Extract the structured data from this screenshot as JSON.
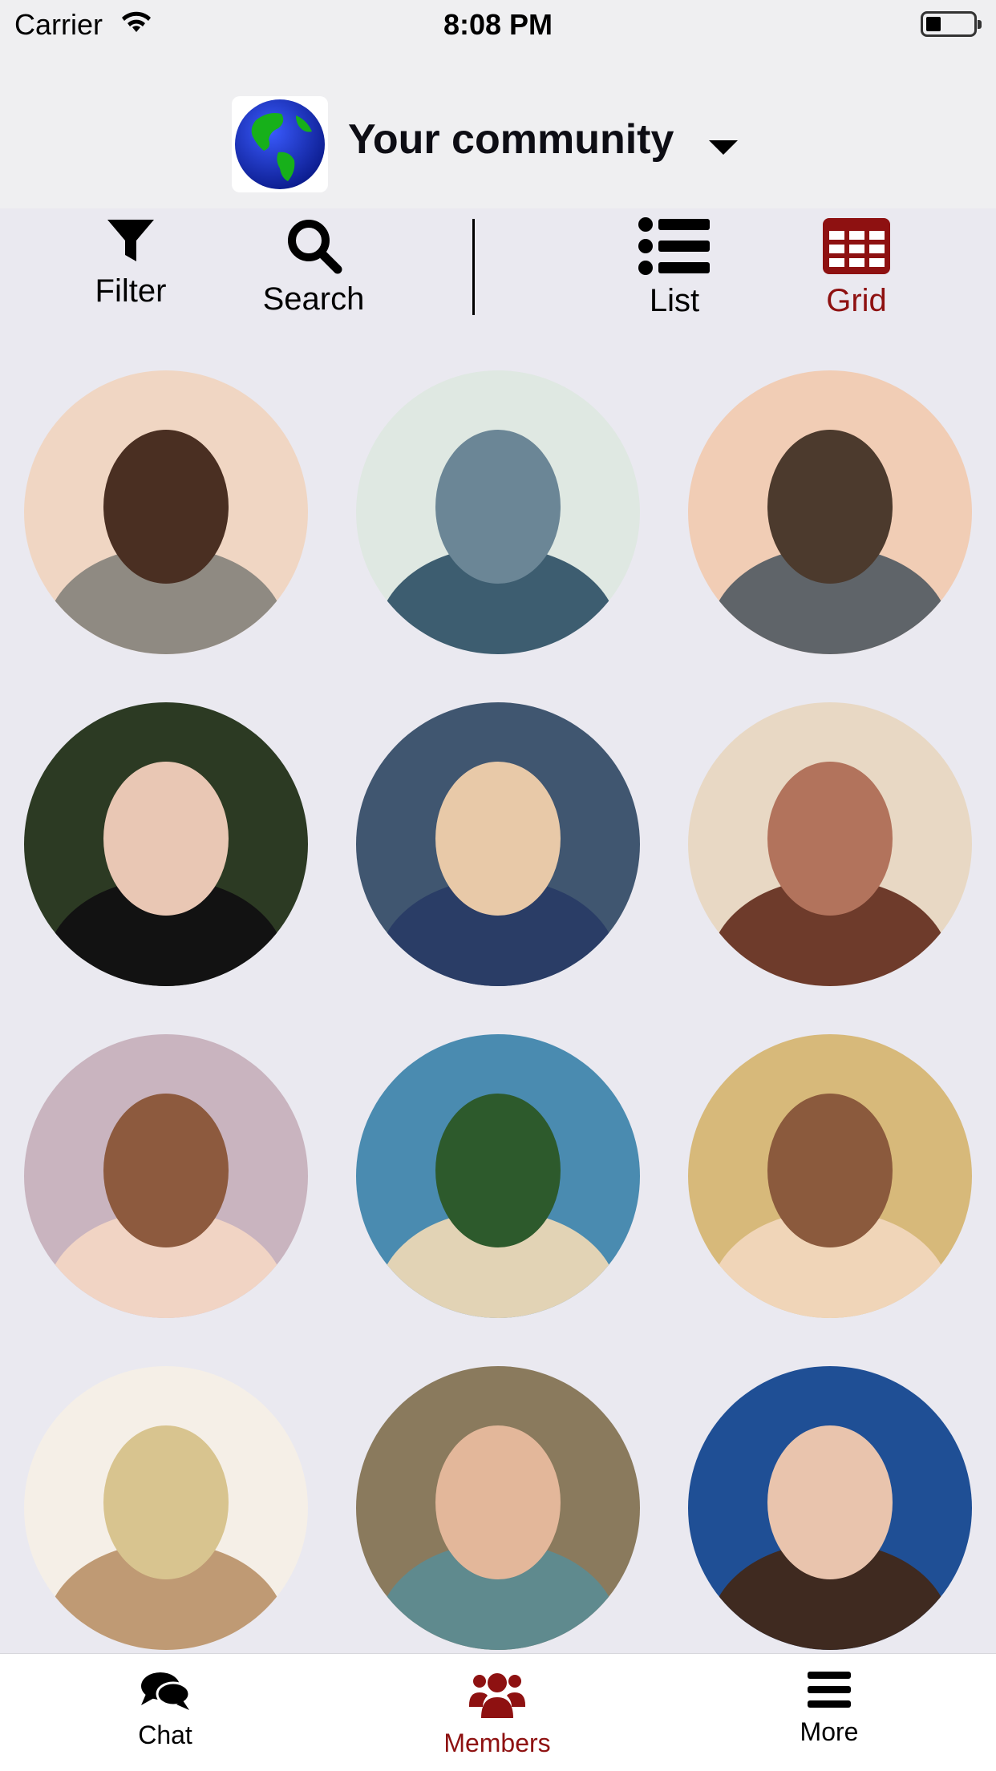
{
  "status_bar": {
    "carrier": "Carrier",
    "time": "8:08 PM"
  },
  "header": {
    "community_title": "Your community"
  },
  "toolbar": {
    "filter_label": "Filter",
    "search_label": "Search",
    "list_label": "List",
    "grid_label": "Grid"
  },
  "members": [
    {
      "tone": [
        "#f0d6c3",
        "#4a2f22",
        "#8f8a82"
      ]
    },
    {
      "tone": [
        "#dfe8e2",
        "#6b8696",
        "#3d5d70"
      ]
    },
    {
      "tone": [
        "#f1cdb5",
        "#4c3a2d",
        "#5f6469"
      ]
    },
    {
      "tone": [
        "#2c3a23",
        "#e9c7b4",
        "#121212"
      ]
    },
    {
      "tone": [
        "#405670",
        "#e8c9a8",
        "#2a3d66"
      ]
    },
    {
      "tone": [
        "#e8d8c4",
        "#b2735c",
        "#6e3b2b"
      ]
    },
    {
      "tone": [
        "#c9b4bf",
        "#8d5a3e",
        "#f1d4c4"
      ]
    },
    {
      "tone": [
        "#4a8bb0",
        "#2d5a2c",
        "#e2d3b5"
      ]
    },
    {
      "tone": [
        "#d7b97a",
        "#8b5a3d",
        "#f0d5b8"
      ]
    },
    {
      "tone": [
        "#f5efe7",
        "#d8c48f",
        "#bf9a74"
      ]
    },
    {
      "tone": [
        "#8a7a5d",
        "#e3b79a",
        "#5f8a8e"
      ]
    },
    {
      "tone": [
        "#1f4f95",
        "#e9c4ad",
        "#3f2a20"
      ]
    }
  ],
  "tabbar": {
    "chat_label": "Chat",
    "members_label": "Members",
    "more_label": "More"
  },
  "colors": {
    "accent": "#8e1111",
    "background": "#eae9f0"
  }
}
